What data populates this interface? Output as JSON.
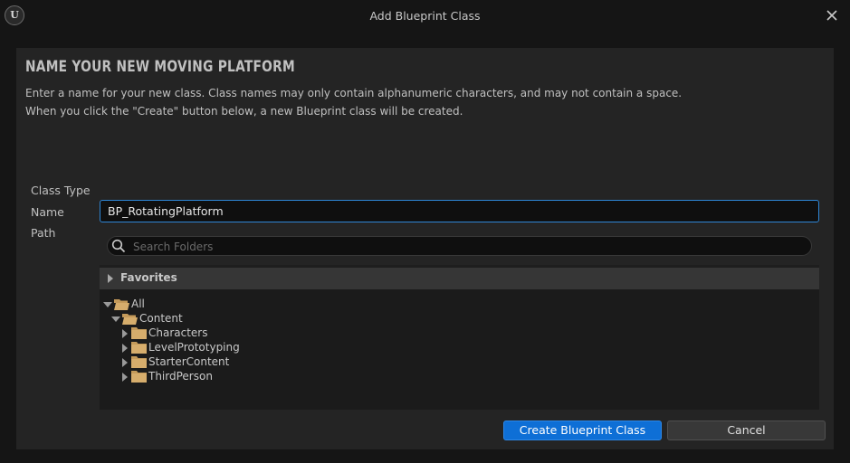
{
  "window": {
    "title": "Add Blueprint Class",
    "logo_text": "U",
    "logo_icon": "unreal-engine-logo",
    "close_icon": "close-icon"
  },
  "dialog": {
    "heading": "NAME YOUR NEW MOVING PLATFORM",
    "description_line1": "Enter a name for your new class. Class names may only contain alphanumeric characters, and may not contain a space.",
    "description_line2": "When you click the \"Create\" button below, a new Blueprint class will be created.",
    "class_type_label": "Class Type",
    "name_label": "Name",
    "name_value": "BP_RotatingPlatform",
    "path_label": "Path",
    "search_placeholder": "Search Folders",
    "favorites_label": "Favorites",
    "tree": {
      "all": "All",
      "content": "Content",
      "children": [
        "Characters",
        "LevelPrototyping",
        "StarterContent",
        "ThirdPerson"
      ]
    },
    "create_button": "Create Blueprint Class",
    "cancel_button": "Cancel"
  },
  "colors": {
    "accent": "#0e6fd6",
    "input_focus_border": "#2e86d6",
    "folder": "#c49a5a"
  }
}
